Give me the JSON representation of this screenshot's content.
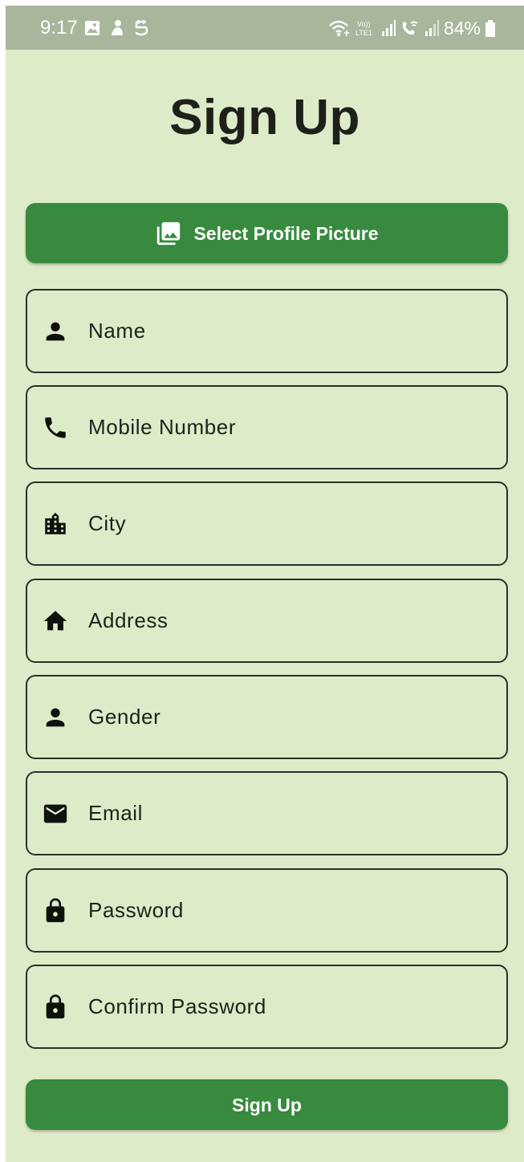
{
  "status_bar": {
    "time": "9:17",
    "battery": "84%"
  },
  "title": "Sign Up",
  "profile_button": {
    "label": "Select Profile Picture",
    "icon": "photo-library-icon"
  },
  "fields": [
    {
      "placeholder": "Name",
      "value": "",
      "icon": "person-icon"
    },
    {
      "placeholder": "Mobile Number",
      "value": "",
      "icon": "phone-icon"
    },
    {
      "placeholder": "City",
      "value": "",
      "icon": "location-city-icon"
    },
    {
      "placeholder": "Address",
      "value": "",
      "icon": "home-icon"
    },
    {
      "placeholder": "Gender",
      "value": "",
      "icon": "person-icon"
    },
    {
      "placeholder": "Email",
      "value": "",
      "icon": "email-icon"
    },
    {
      "placeholder": "Password",
      "value": "",
      "icon": "lock-icon"
    },
    {
      "placeholder": "Confirm Password",
      "value": "",
      "icon": "lock-icon"
    }
  ],
  "signup_button": {
    "label": "Sign Up"
  },
  "colors": {
    "background": "#deebc9",
    "status_bar": "#a9b69c",
    "primary": "#388a3f",
    "text": "#1d211a",
    "border": "#2b2f28"
  }
}
